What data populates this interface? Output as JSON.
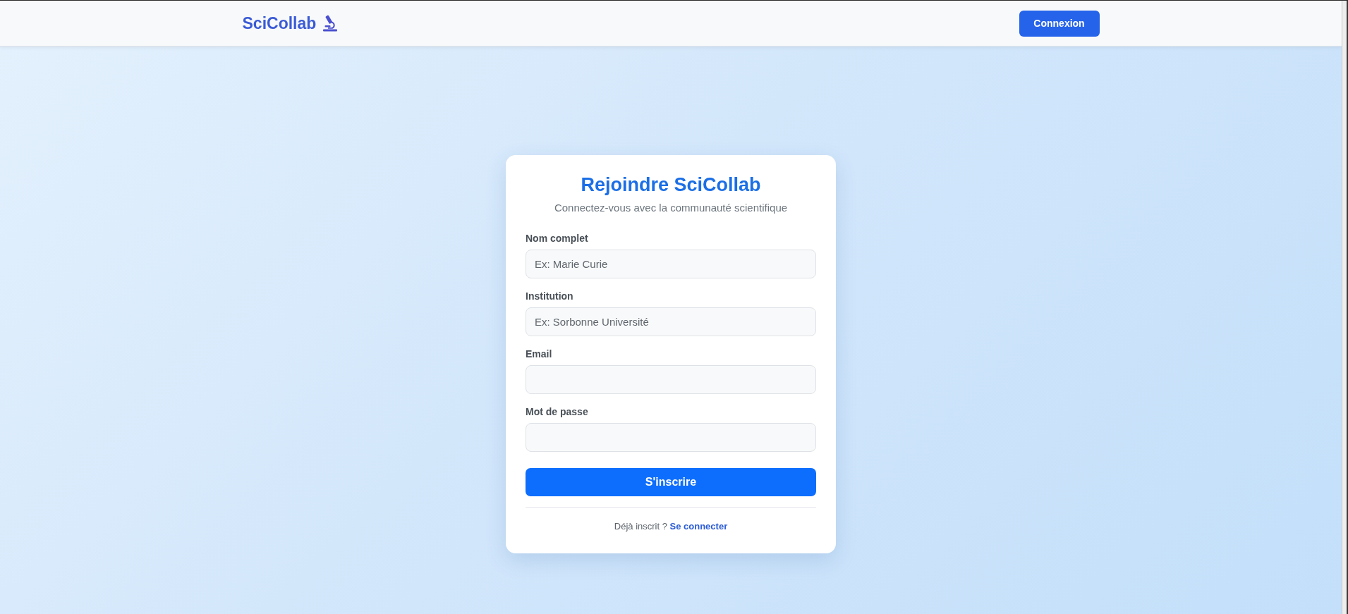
{
  "header": {
    "logo": "SciCollab",
    "login_button": "Connexion"
  },
  "card": {
    "title": "Rejoindre SciCollab",
    "subtitle": "Connectez-vous avec la communauté scientifique",
    "fields": [
      {
        "label": "Nom complet",
        "placeholder": "Ex: Marie Curie"
      },
      {
        "label": "Institution",
        "placeholder": "Ex: Sorbonne Université"
      },
      {
        "label": "Email"
      },
      {
        "label": "Mot de passe"
      }
    ],
    "submit_button": "S'inscrire",
    "footer": {
      "text": "Déjà inscrit ?",
      "link": "Se connecter"
    }
  }
}
